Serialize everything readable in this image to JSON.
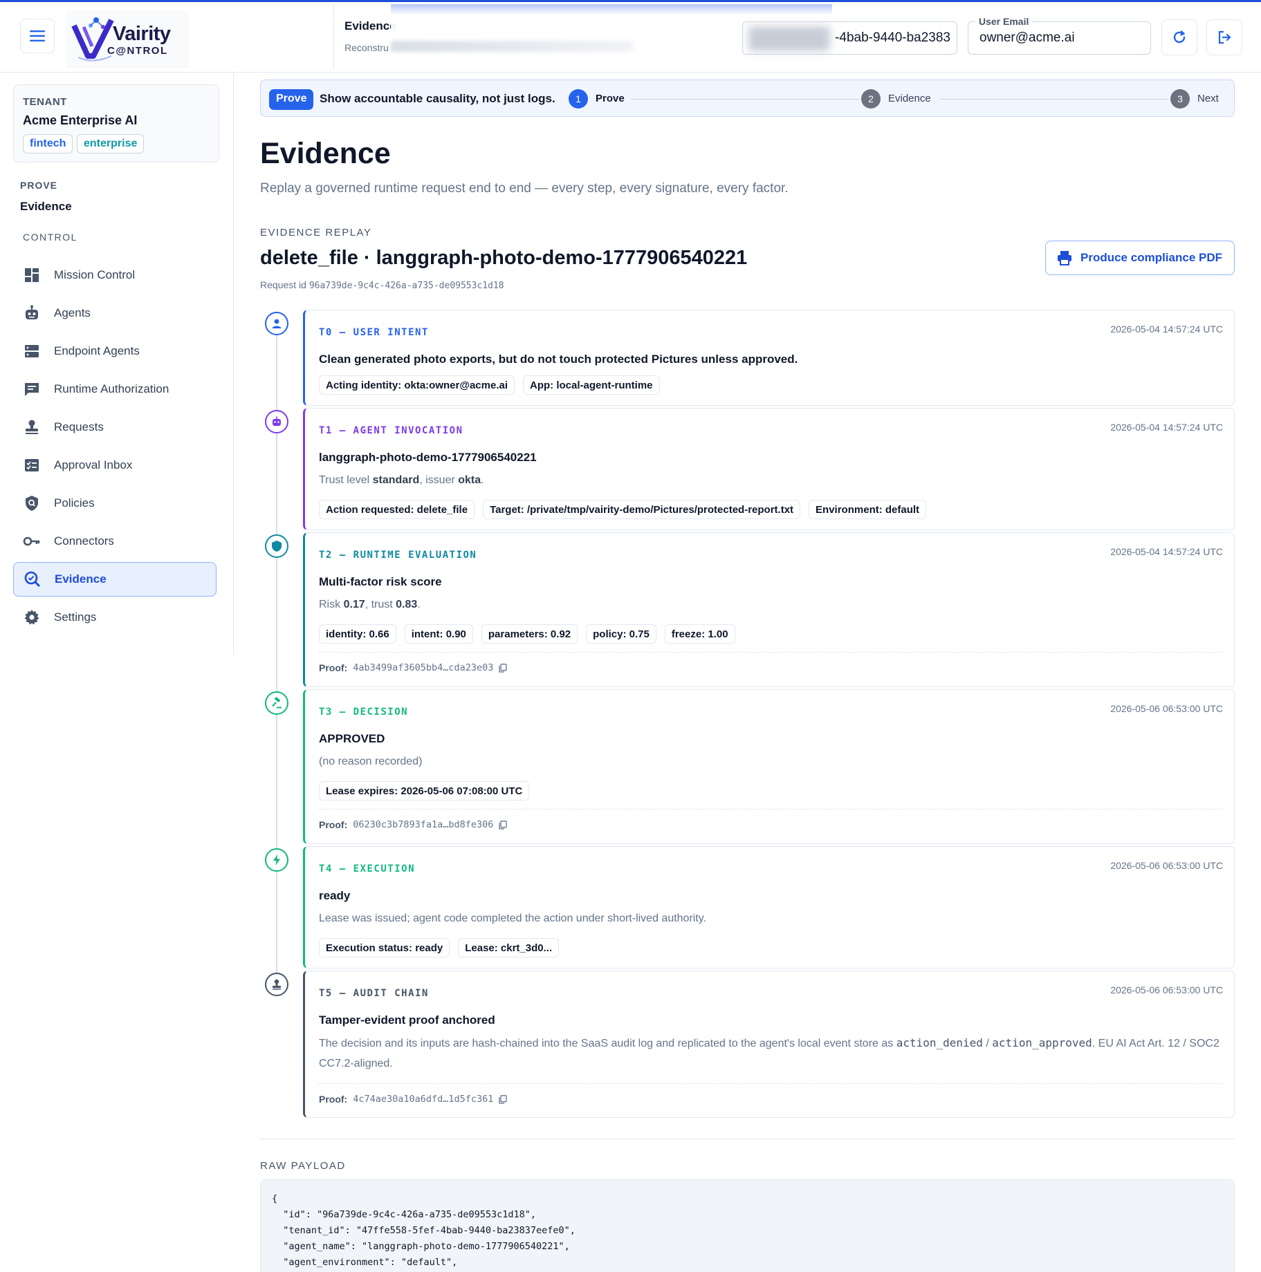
{
  "topbar": {
    "title": "Evidence",
    "subtitle": "Reconstru",
    "tenant_value": "-4bab-9440-ba2383",
    "email_label": "User Email",
    "email_value": "owner@acme.ai",
    "logo_word": "Vairity",
    "logo_sub": "C@NTROL"
  },
  "sidebar": {
    "tenant_label": "TENANT",
    "tenant_name": "Acme Enterprise AI",
    "tags": [
      "fintech",
      "enterprise"
    ],
    "prove_label": "PROVE",
    "prove_item": "Evidence",
    "control_label": "CONTROL",
    "items": [
      {
        "label": "Mission Control",
        "icon": "dashboard-icon"
      },
      {
        "label": "Agents",
        "icon": "robot-icon"
      },
      {
        "label": "Endpoint Agents",
        "icon": "server-icon"
      },
      {
        "label": "Runtime Authorization",
        "icon": "message-icon"
      },
      {
        "label": "Requests",
        "icon": "stamp-icon"
      },
      {
        "label": "Approval Inbox",
        "icon": "checklist-icon"
      },
      {
        "label": "Policies",
        "icon": "shield-search-icon"
      },
      {
        "label": "Connectors",
        "icon": "key-icon"
      },
      {
        "label": "Evidence",
        "icon": "evidence-search-icon",
        "active": true
      },
      {
        "label": "Settings",
        "icon": "gear-icon"
      }
    ]
  },
  "stepper": {
    "pill": "Prove",
    "message": "Show accountable causality, not just logs.",
    "steps": [
      {
        "num": "1",
        "label": "Prove",
        "active": true
      },
      {
        "num": "2",
        "label": "Evidence"
      },
      {
        "num": "3",
        "label": "Next"
      }
    ]
  },
  "page": {
    "title": "Evidence",
    "subtitle": "Replay a governed runtime request end to end — every step, every signature, every factor.",
    "replay_label": "EVIDENCE REPLAY",
    "replay_title": "delete_file · langgraph-photo-demo-1777906540221",
    "request_label": "Request id",
    "request_id": "96a739de-9c4c-426a-a735-de09553c1d18",
    "pdf_button": "Produce compliance PDF"
  },
  "timeline": [
    {
      "tag": "T0 — USER INTENT",
      "timestamp": "2026-05-04 14:57:24 UTC",
      "heading": "Clean generated photo exports, but do not touch protected Pictures unless approved.",
      "chips": [
        "Acting identity: okta:owner@acme.ai",
        "App: local-agent-runtime"
      ],
      "color": "#2563eb",
      "icon": "user-icon"
    },
    {
      "tag": "T1 — AGENT INVOCATION",
      "timestamp": "2026-05-04 14:57:24 UTC",
      "heading": "langgraph-photo-demo-1777906540221",
      "desc_pre": "Trust level ",
      "desc_b1": "standard",
      "desc_mid": ", issuer ",
      "desc_b2": "okta",
      "desc_post": ".",
      "chips": [
        "Action requested: delete_file",
        "Target: /private/tmp/vairity-demo/Pictures/protected-report.txt",
        "Environment: default"
      ],
      "color": "#7c3aed",
      "icon": "robot-icon"
    },
    {
      "tag": "T2 — RUNTIME EVALUATION",
      "timestamp": "2026-05-04 14:57:24 UTC",
      "heading": "Multi-factor risk score",
      "desc_pre": "Risk ",
      "desc_b1": "0.17",
      "desc_mid": ", trust ",
      "desc_b2": "0.83",
      "desc_post": ".",
      "chips": [
        "identity: 0.66",
        "intent: 0.90",
        "parameters: 0.92",
        "policy: 0.75",
        "freeze: 1.00"
      ],
      "proof_label": "Proof:",
      "proof": "4ab3499af3605bb4…cda23e03",
      "color": "#0e8aa0",
      "icon": "shield-icon"
    },
    {
      "tag": "T3 — DECISION",
      "timestamp": "2026-05-06 06:53:00 UTC",
      "heading": "APPROVED",
      "desc": "(no reason recorded)",
      "chips": [
        "Lease expires: 2026-05-06 07:08:00 UTC"
      ],
      "proof_label": "Proof:",
      "proof": "06230c3b7893fa1a…bd8fe306",
      "color": "#10b981",
      "icon": "gavel-icon"
    },
    {
      "tag": "T4 — EXECUTION",
      "timestamp": "2026-05-06 06:53:00 UTC",
      "heading": "ready",
      "desc": "Lease was issued; agent code completed the action under short-lived authority.",
      "chips": [
        "Execution status: ready",
        "Lease: ckrt_3d0..."
      ],
      "color": "#10b981",
      "icon": "bolt-icon"
    },
    {
      "tag": "T5 — AUDIT CHAIN",
      "timestamp": "2026-05-06 06:53:00 UTC",
      "heading": "Tamper-evident proof anchored",
      "desc_pre": "The decision and its inputs are hash-chained into the SaaS audit log and replicated to the agent's local event store as ",
      "code1": "action_denied",
      "desc_mid": " / ",
      "code2": "action_approved",
      "desc_post": ". EU AI Act Art. 12 / SOC2 CC7.2-aligned.",
      "proof_label": "Proof:",
      "proof": "4c74ae30a10a6dfd…1d5fc361",
      "color": "#475569",
      "icon": "stamp-icon"
    }
  ],
  "raw": {
    "label": "RAW PAYLOAD",
    "lines": [
      "{",
      "  \"id\": \"96a739de-9c4c-426a-a735-de09553c1d18\",",
      "  \"tenant_id\": \"47ffe558-5fef-4bab-9440-ba23837eefe0\",",
      "  \"agent_name\": \"langgraph-photo-demo-1777906540221\",",
      "  \"agent_environment\": \"default\","
    ]
  }
}
